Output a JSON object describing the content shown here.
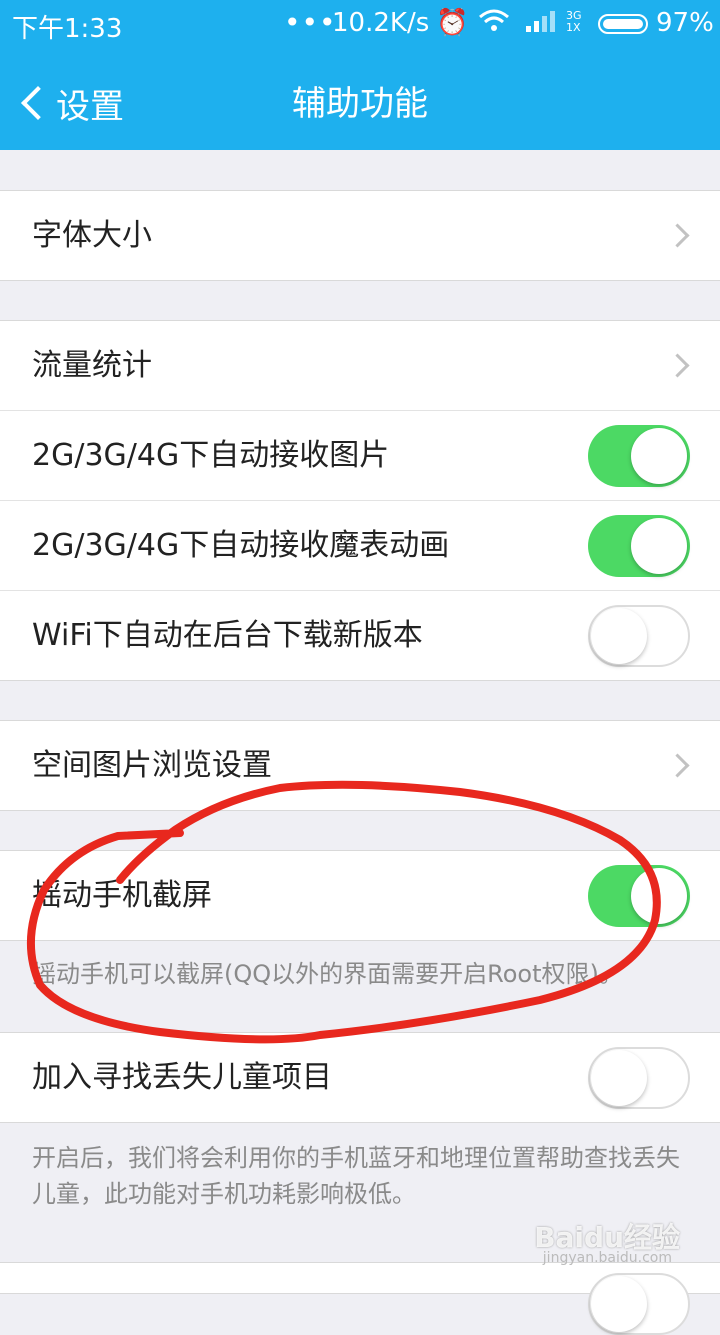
{
  "status_bar": {
    "time": "下午1:33",
    "dots": "•••",
    "speed": "10.2K/s",
    "network": "3G 1X",
    "battery": "97%"
  },
  "nav": {
    "back_label": "设置",
    "title": "辅助功能"
  },
  "rows": {
    "font_size": "字体大小",
    "traffic": "流量统计",
    "auto_image": "2G/3G/4G下自动接收图片",
    "auto_magic": "2G/3G/4G下自动接收魔表动画",
    "wifi_download": "WiFi下自动在后台下载新版本",
    "zone_browse": "空间图片浏览设置",
    "shake_screenshot": "摇动手机截屏",
    "lost_child": "加入寻找丢失儿童项目"
  },
  "toggles": {
    "auto_image": true,
    "auto_magic": true,
    "wifi_download": false,
    "shake_screenshot": true,
    "lost_child": false
  },
  "notes": {
    "shake": "摇动手机可以截屏(QQ以外的界面需要开启Root权限)。",
    "lost_child": "开启后，我们将会利用你的手机蓝牙和地理位置帮助查找丢失儿童，此功能对手机功耗影响极低。"
  },
  "watermark": {
    "brand": "Baidu经验",
    "site": "jingyan.baidu.com"
  },
  "colors": {
    "header": "#1eb0ee",
    "toggle_on": "#4cd964",
    "annotation": "#e8281e"
  }
}
